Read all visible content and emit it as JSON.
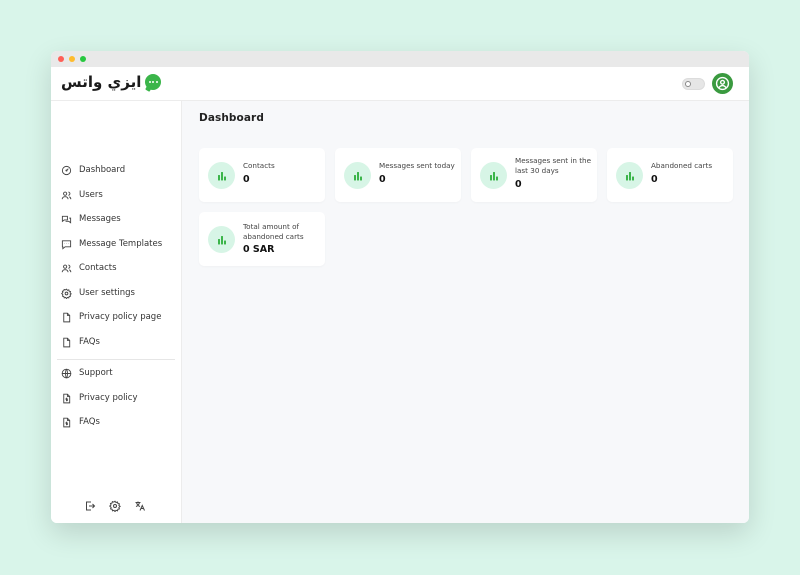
{
  "app": {
    "logo_text": "ايزي واتس"
  },
  "sidebar": {
    "items": [
      {
        "label": "Dashboard",
        "icon": "dashboard-icon"
      },
      {
        "label": "Users",
        "icon": "users-icon"
      },
      {
        "label": "Messages",
        "icon": "messages-icon"
      },
      {
        "label": "Message Templates",
        "icon": "message-template-icon"
      },
      {
        "label": "Contacts",
        "icon": "contacts-icon"
      },
      {
        "label": "User settings",
        "icon": "settings-icon"
      },
      {
        "label": "Privacy policy page",
        "icon": "document-icon"
      },
      {
        "label": "FAQs",
        "icon": "document-icon"
      }
    ],
    "secondary": [
      {
        "label": "Support",
        "icon": "globe-icon"
      },
      {
        "label": "Privacy policy",
        "icon": "file-dollar-icon"
      },
      {
        "label": "FAQs",
        "icon": "file-dollar-icon"
      }
    ]
  },
  "main": {
    "title": "Dashboard",
    "cards": [
      {
        "label": "Contacts",
        "value": "0"
      },
      {
        "label": "Messages sent today",
        "value": "0"
      },
      {
        "label": "Messages sent in the last 30 days",
        "value": "0"
      },
      {
        "label": "Abandoned carts",
        "value": "0"
      },
      {
        "label": "Total amount of abandoned carts",
        "value": "0 SAR"
      }
    ]
  },
  "colors": {
    "accent": "#3bb54a",
    "icon_bg": "#d7f5e6",
    "page_bg": "#d9f5ea"
  }
}
